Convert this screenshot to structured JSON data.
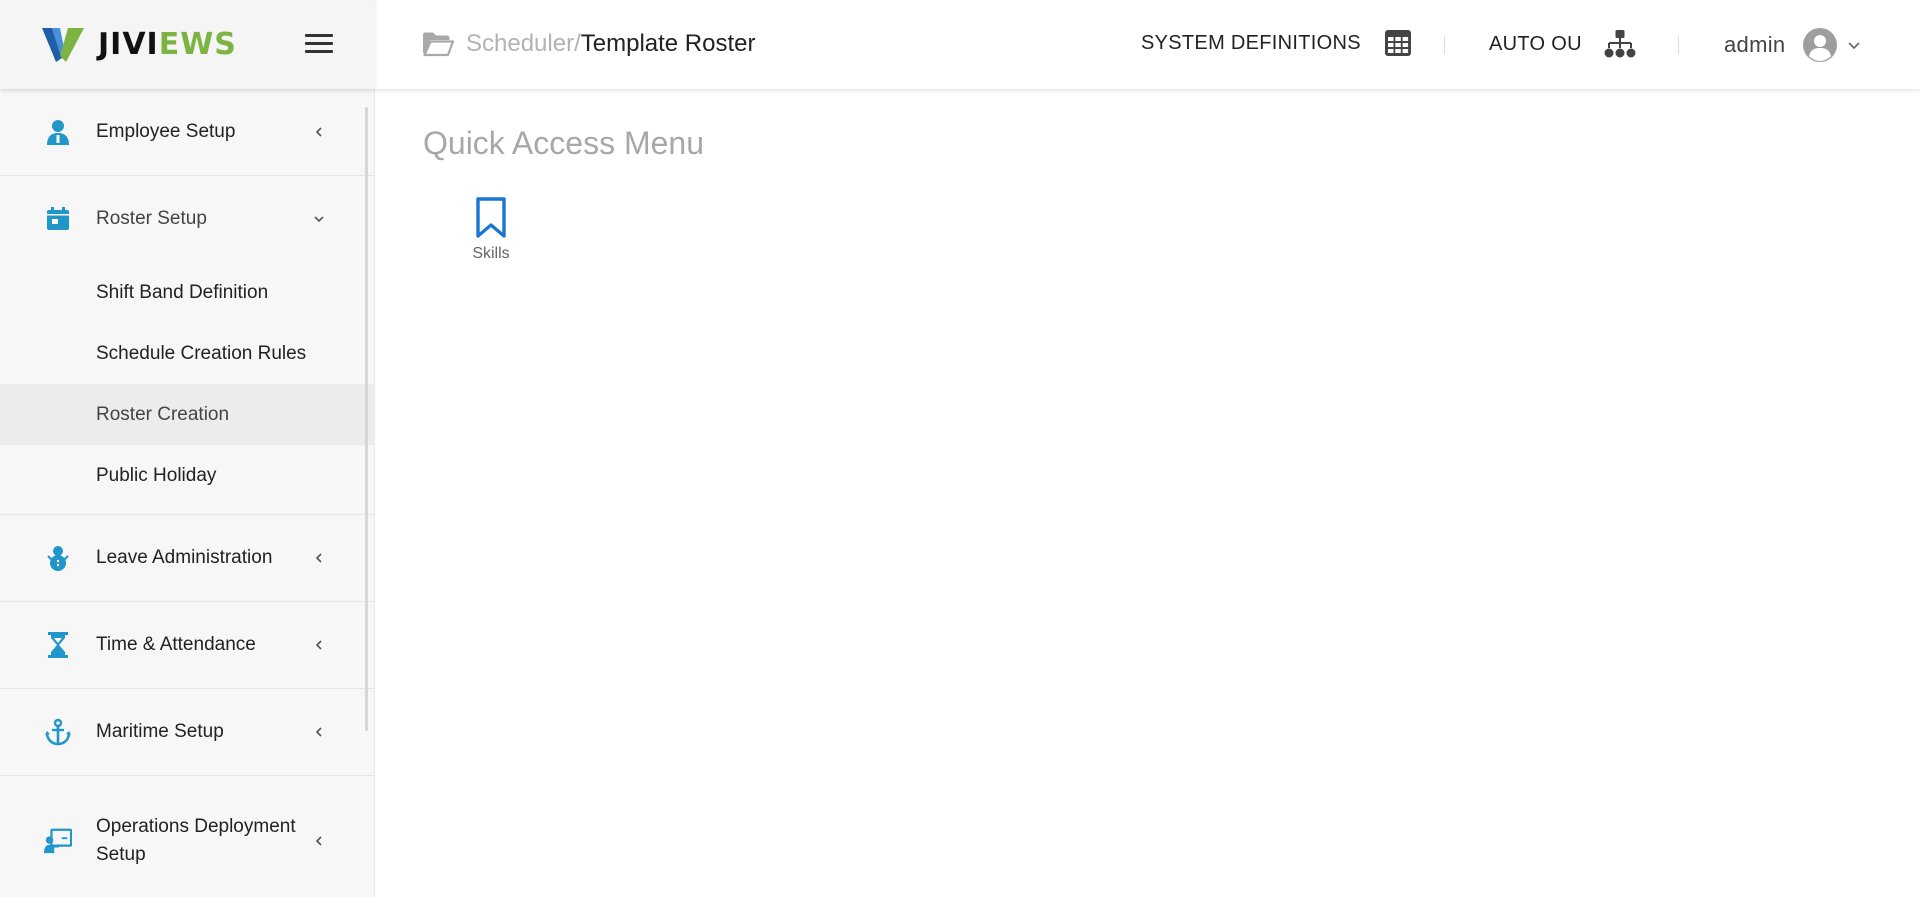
{
  "app": {
    "logo_text_dark": "JIVI",
    "logo_text_green": "EWS",
    "colors": {
      "accent_blue": "#1976d2",
      "icon_blue": "#2196c9",
      "brand_green": "#7cb342"
    }
  },
  "header": {
    "breadcrumb_parent": "Scheduler",
    "breadcrumb_separator": "/",
    "breadcrumb_current": "Template Roster",
    "system_definitions_label": "SYSTEM DEFINITIONS",
    "auto_ou_label": "AUTO OU",
    "user_label": "admin"
  },
  "sidebar": {
    "items": [
      {
        "label": "Employee Setup",
        "icon": "person-icon",
        "expanded": false
      },
      {
        "label": "Roster Setup",
        "icon": "calendar-icon",
        "expanded": true,
        "children": [
          {
            "label": "Shift Band Definition"
          },
          {
            "label": "Schedule Creation Rules"
          },
          {
            "label": "Roster Creation",
            "active": true
          },
          {
            "label": "Public Holiday"
          }
        ]
      },
      {
        "label": "Leave Administration",
        "icon": "snowman-icon",
        "expanded": false
      },
      {
        "label": "Time & Attendance",
        "icon": "hourglass-icon",
        "expanded": false
      },
      {
        "label": "Maritime Setup",
        "icon": "anchor-icon",
        "expanded": false
      },
      {
        "label": "Operations Deployment Setup",
        "label_line1": "Operations Deployment",
        "label_line2": "Setup",
        "icon": "presentation-icon",
        "expanded": false
      }
    ]
  },
  "main": {
    "title": "Quick Access Menu",
    "tiles": [
      {
        "label": "Skills",
        "icon": "bookmark-icon"
      }
    ]
  }
}
